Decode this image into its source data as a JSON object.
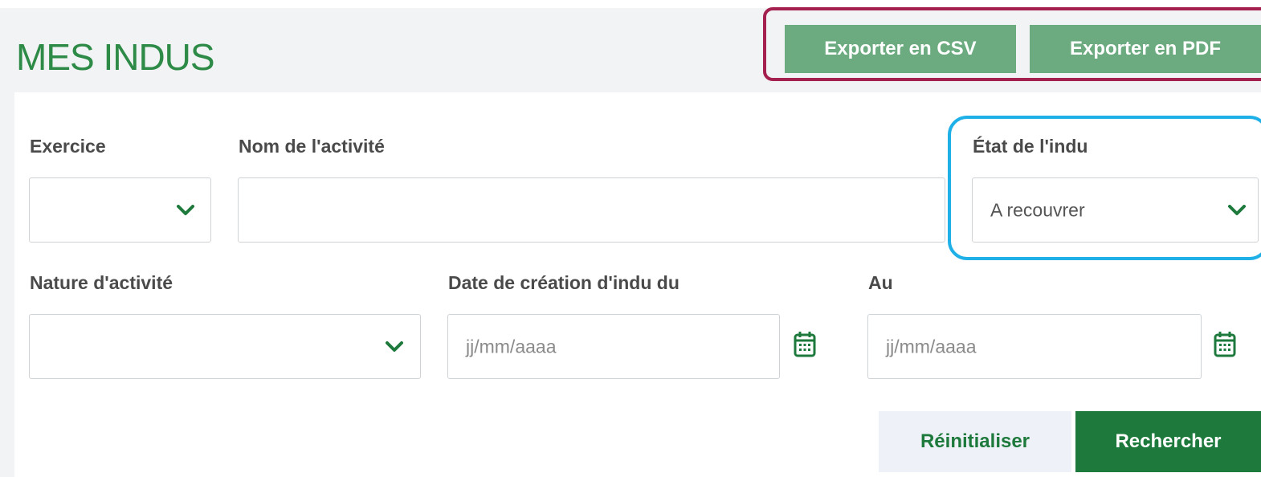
{
  "header": {
    "title": "MES INDUS",
    "export_csv_label": "Exporter en CSV",
    "export_pdf_label": "Exporter en PDF"
  },
  "filters": {
    "exercice": {
      "label": "Exercice",
      "value": ""
    },
    "nom_activite": {
      "label": "Nom de l'activité",
      "value": ""
    },
    "etat_indu": {
      "label": "État de l'indu",
      "value": "A recouvrer"
    },
    "nature_activite": {
      "label": "Nature d'activité",
      "value": ""
    },
    "date_du": {
      "label": "Date de création d'indu du",
      "placeholder": "jj/mm/aaaa"
    },
    "date_au": {
      "label": "Au",
      "placeholder": "jj/mm/aaaa"
    }
  },
  "actions": {
    "reset_label": "Réinitialiser",
    "search_label": "Rechercher"
  },
  "icons": {
    "dropdown": "chevron-down-icon",
    "calendar": "calendar-icon"
  },
  "colors": {
    "brand_green": "#1e7a3c",
    "export_green": "#6cab7f",
    "annotation_red": "#a3204f",
    "annotation_blue": "#1fb0e8"
  }
}
